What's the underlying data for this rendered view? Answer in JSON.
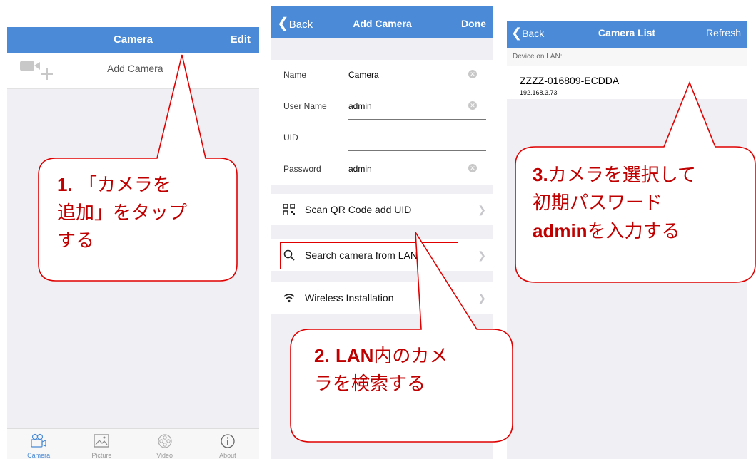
{
  "screen1": {
    "title": "Camera",
    "edit_label": "Edit",
    "add_camera_label": "Add Camera",
    "tabs": [
      {
        "label": "Camera",
        "icon": "camera-tab-icon"
      },
      {
        "label": "Picture",
        "icon": "picture-tab-icon"
      },
      {
        "label": "Video",
        "icon": "video-tab-icon"
      },
      {
        "label": "About",
        "icon": "info-tab-icon"
      }
    ]
  },
  "screen2": {
    "back_label": "Back",
    "title": "Add Camera",
    "done_label": "Done",
    "fields": [
      {
        "label": "Name",
        "value": "Camera"
      },
      {
        "label": "User Name",
        "value": "admin"
      },
      {
        "label": "UID",
        "value": ""
      },
      {
        "label": "Password",
        "value": "admin"
      }
    ],
    "scan_label": "Scan QR Code add UID",
    "search_label": "Search camera from LAN",
    "wireless_label": "Wireless Installation"
  },
  "screen3": {
    "back_label": "Back",
    "title": "Camera List",
    "refresh_label": "Refresh",
    "section_header": "Device on LAN:",
    "device_name": "ZZZZ-016809-ECDDA",
    "device_ip": "192.168.3.73"
  },
  "callouts": {
    "c1_num": "1.",
    "c1_text_a": "「カメラを",
    "c1_text_b": "追加」をタップ",
    "c1_text_c": "する",
    "c2_num": "2.",
    "c2_lan": "LAN",
    "c2_text_a": "内のカメ",
    "c2_text_b": "ラを検索する",
    "c3_num": "3.",
    "c3_text_a": "カメラを選択して",
    "c3_text_b": "初期パスワード",
    "c3_admin": "admin",
    "c3_text_c": "を入力する"
  },
  "colors": {
    "navbar": "#4a8ad6",
    "callout_text": "#c00000",
    "callout_border": "#e00000"
  }
}
